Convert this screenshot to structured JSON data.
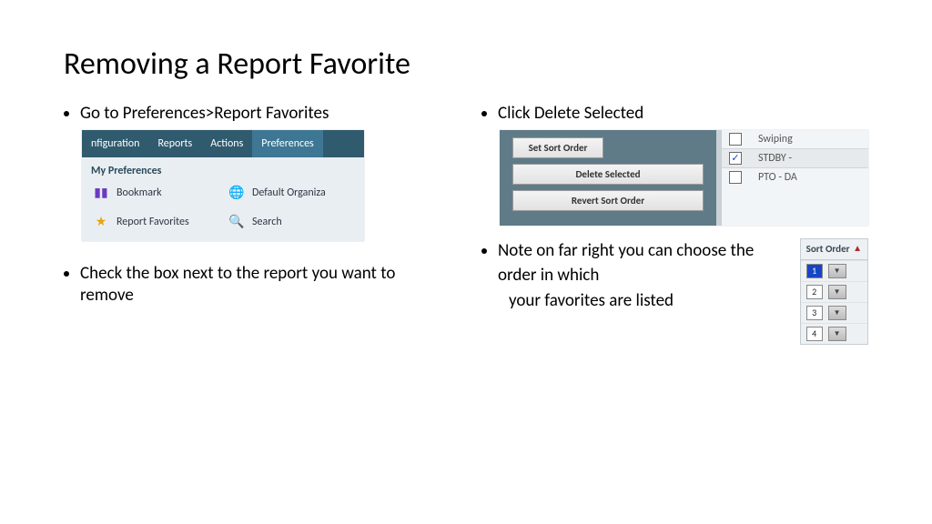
{
  "title": "Removing a Report Favorite",
  "left": {
    "bullet1": "Go to Preferences>Report Favorites",
    "bullet2": "Check the box next to the report you want to remove"
  },
  "right": {
    "bullet1": "Click Delete Selected",
    "bullet2a": "Note on far right you can choose the order in which",
    "bullet2b": "your favorites are listed"
  },
  "nav": {
    "items": [
      "nfiguration",
      "Reports",
      "Actions",
      "Preferences"
    ]
  },
  "prefs": {
    "heading": "My Preferences",
    "items": [
      {
        "label": "Bookmark"
      },
      {
        "label": "Default Organiza"
      },
      {
        "label": "Report Favorites"
      },
      {
        "label": "Search"
      }
    ]
  },
  "buttons": {
    "set": "Set Sort Order",
    "delete": "Delete Selected",
    "revert": "Revert Sort Order"
  },
  "rows": [
    {
      "checked": false,
      "label": "Swiping"
    },
    {
      "checked": true,
      "label": "STDBY -"
    },
    {
      "checked": false,
      "label": "PTO - DA"
    }
  ],
  "sort": {
    "heading": "Sort Order",
    "values": [
      "1",
      "2",
      "3",
      "4"
    ]
  }
}
